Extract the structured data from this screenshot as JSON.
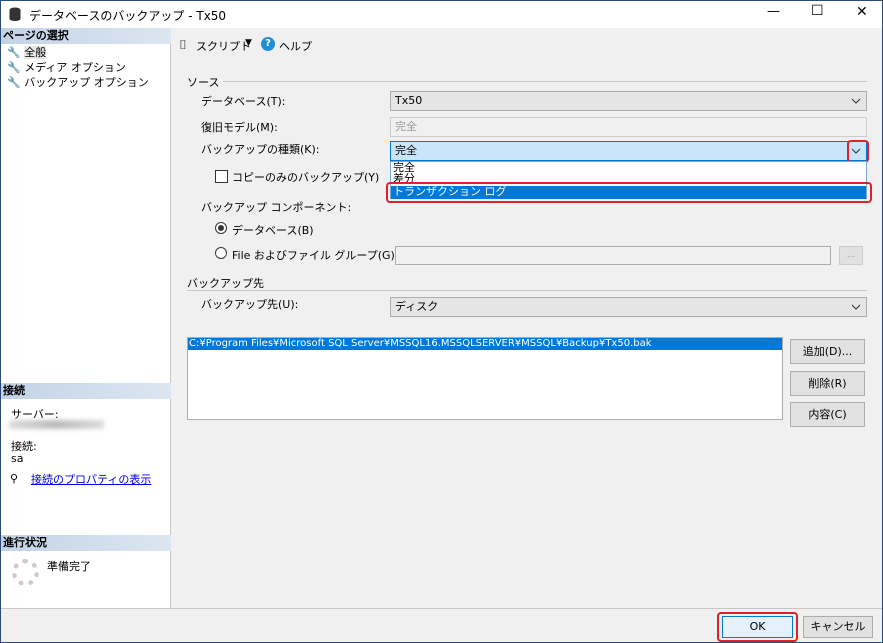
{
  "window": {
    "title": "データベースのバックアップ - Tx50",
    "minimize": "—",
    "maximize": "☐",
    "close": "✕"
  },
  "left": {
    "page_select_header": "ページの選択",
    "pages": [
      {
        "label": "全般"
      },
      {
        "label": "メディア オプション"
      },
      {
        "label": "バックアップ オプション"
      }
    ],
    "connection_header": "接続",
    "server_label": "サーバー:",
    "connection_label": "接続:",
    "connection_value": "sa",
    "connection_link": "接続のプロパティの表示",
    "progress_header": "進行状況",
    "progress_status": "準備完了"
  },
  "toolbar": {
    "script": "スクリプト",
    "help": "ヘルプ"
  },
  "source": {
    "section": "ソース",
    "database_label": "データベース(T):",
    "database_value": "Tx50",
    "recovery_label": "復旧モデル(M):",
    "recovery_value": "完全",
    "type_label": "バックアップの種類(K):",
    "type_value": "完全",
    "type_options": [
      "完全",
      "差分",
      "トランザクション ログ"
    ],
    "copy_only_label": "コピーのみのバックアップ(Y)",
    "copy_only_checked": false,
    "component_label": "バックアップ コンポーネント:",
    "component_db": "データベース(B)",
    "component_file": "File およびファイル グループ(G):",
    "component_selected": "データベース(B)",
    "browse": "..."
  },
  "destination": {
    "section": "バックアップ先",
    "dest_label": "バックアップ先(U):",
    "dest_value": "ディスク",
    "paths": [
      "C:¥Program Files¥Microsoft SQL Server¥MSSQL16.MSSQLSERVER¥MSSQL¥Backup¥Tx50.bak"
    ],
    "add": "追加(D)...",
    "remove": "削除(R)",
    "contents": "内容(C)"
  },
  "footer": {
    "ok": "OK",
    "cancel": "キャンセル"
  },
  "colors": {
    "selection": "#0078d7",
    "highlight_outline": "#e0202a",
    "link": "#0000ee"
  }
}
